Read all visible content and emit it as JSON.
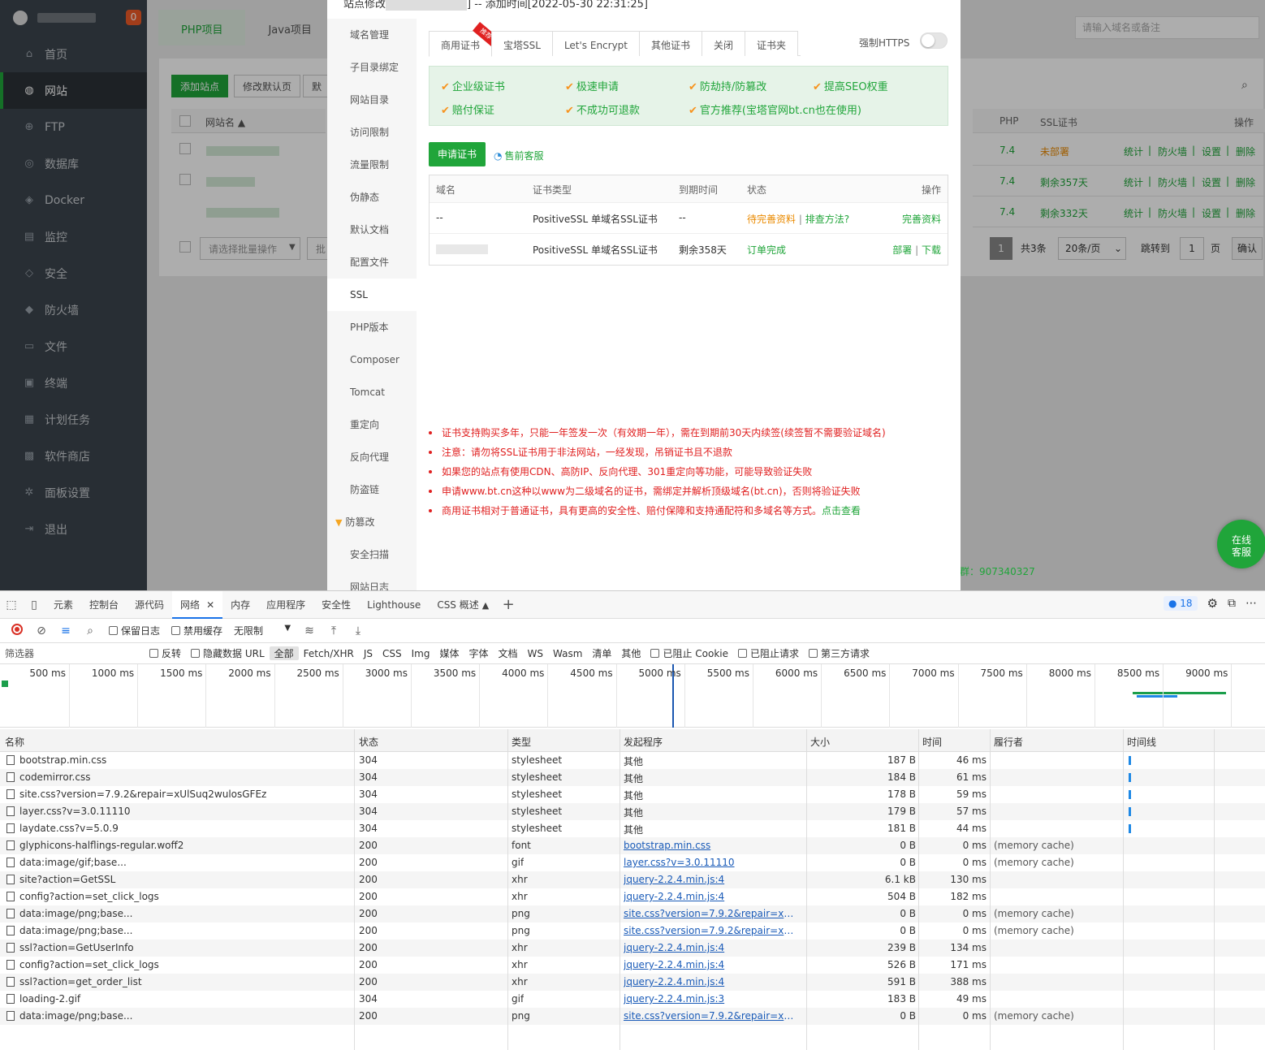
{
  "sidebar": {
    "badge": "0",
    "items": [
      {
        "label": "首页",
        "icon": "home-icon",
        "glyph": "⌂"
      },
      {
        "label": "网站",
        "icon": "globe-icon",
        "glyph": "◍"
      },
      {
        "label": "FTP",
        "icon": "ftp-icon",
        "glyph": "⊕"
      },
      {
        "label": "数据库",
        "icon": "database-icon",
        "glyph": "◎"
      },
      {
        "label": "Docker",
        "icon": "docker-icon",
        "glyph": "◈"
      },
      {
        "label": "监控",
        "icon": "monitor-icon",
        "glyph": "▤"
      },
      {
        "label": "安全",
        "icon": "shield-icon",
        "glyph": "◇"
      },
      {
        "label": "防火墙",
        "icon": "firewall-icon",
        "glyph": "◆"
      },
      {
        "label": "文件",
        "icon": "folder-icon",
        "glyph": "▭"
      },
      {
        "label": "终端",
        "icon": "terminal-icon",
        "glyph": "▣"
      },
      {
        "label": "计划任务",
        "icon": "calendar-icon",
        "glyph": "▦"
      },
      {
        "label": "软件商店",
        "icon": "apps-icon",
        "glyph": "▩"
      },
      {
        "label": "面板设置",
        "icon": "gear-icon",
        "glyph": "✲"
      },
      {
        "label": "退出",
        "icon": "logout-icon",
        "glyph": "⇥"
      }
    ]
  },
  "main": {
    "tabs": [
      "PHP项目",
      "Java项目"
    ],
    "buttons": {
      "add_site": "添加站点",
      "modify_default": "修改默认页",
      "default_partial": "默认"
    },
    "col_sitename": "网站名 ▲",
    "search_placeholder": "请输入域名或备注",
    "right_headers": {
      "php": "PHP",
      "ssl": "SSL证书",
      "ops": "操作"
    },
    "rows": [
      {
        "php": "7.4",
        "ssl": "未部署"
      },
      {
        "php": "7.4",
        "ssl": "剩余357天"
      },
      {
        "php": "7.4",
        "ssl": "剩余332天"
      }
    ],
    "row_ops": [
      "统计",
      "防火墙",
      "设置",
      "删除"
    ],
    "batch_placeholder": "请选择批量操作",
    "batch_btn_partial": "批量",
    "pager": {
      "page": "1",
      "total": "共3条",
      "per_page": "20条/页",
      "jump_label": "跳转到",
      "jump_value": "1",
      "page_unit": "页",
      "confirm": "确认"
    },
    "footer_partial": "群：907340327",
    "online_service": "在线客服"
  },
  "dialog": {
    "title_prefix": "站点修改",
    "title_suffix": "] -- 添加时间[2022-05-30 22:31:25]",
    "menu": [
      "域名管理",
      "子目录绑定",
      "网站目录",
      "访问限制",
      "流量限制",
      "伪静态",
      "默认文档",
      "配置文件",
      "SSL",
      "PHP版本",
      "Composer",
      "Tomcat",
      "重定向",
      "反向代理",
      "防盗链",
      "防篡改",
      "安全扫描",
      "网站日志"
    ],
    "tabs": [
      "商用证书",
      "宝塔SSL",
      "Let's Encrypt",
      "其他证书",
      "关闭",
      "证书夹"
    ],
    "recommend_ribbon": "推荐",
    "force_https": "强制HTTPS",
    "features": [
      "企业级证书",
      "极速申请",
      "防劫持/防篡改",
      "提高SEO权重",
      "赔付保证",
      "不成功可退款",
      "官方推荐(宝塔官网bt.cn也在使用)"
    ],
    "apply_btn": "申请证书",
    "presale": "售前客服",
    "table_headers": [
      "域名",
      "证书类型",
      "到期时间",
      "状态",
      "操作"
    ],
    "cert_rows": [
      {
        "domain": "--",
        "type": "PositiveSSL 单域名SSL证书",
        "expire": "--",
        "status": "待完善资料",
        "status_link": "排查方法?",
        "action1": "完善资料",
        "action2": ""
      },
      {
        "domain": "",
        "type": "PositiveSSL 单域名SSL证书",
        "expire": "剩余358天",
        "status": "订单完成",
        "status_link": "",
        "action1": "部署",
        "action2": "下载"
      }
    ],
    "notes": [
      "证书支持购买多年，只能一年签发一次（有效期一年），需在到期前30天内续签(续签暂不需要验证域名)",
      "注意：请勿将SSL证书用于非法网站，一经发现，吊销证书且不退款",
      "如果您的站点有使用CDN、高防IP、反向代理、301重定向等功能，可能导致验证失败",
      "申请www.bt.cn这种以www为二级域名的证书，需绑定并解析顶级域名(bt.cn)，否则将验证失败",
      "商用证书相对于普通证书，具有更高的安全性、赔付保障和支持通配符和多域名等方式。"
    ],
    "notes_link": "点击查看"
  },
  "devtools": {
    "tabs": [
      "元素",
      "控制台",
      "源代码",
      "网络",
      "内存",
      "应用程序",
      "安全性",
      "Lighthouse",
      "CSS 概述"
    ],
    "issues_count": "18",
    "toolbar": {
      "preserve_log": "保留日志",
      "disable_cache": "禁用缓存",
      "throttle": "无限制"
    },
    "filter": {
      "label": "筛选器",
      "invert": "反转",
      "hide_data_url": "隐藏数据 URL",
      "types": [
        "全部",
        "Fetch/XHR",
        "JS",
        "CSS",
        "Img",
        "媒体",
        "字体",
        "文档",
        "WS",
        "Wasm",
        "清单",
        "其他"
      ],
      "blocked_cookies": "已阻止 Cookie",
      "blocked_requests": "已阻止请求",
      "third_party": "第三方请求"
    },
    "timeline_ticks": [
      "500 ms",
      "1000 ms",
      "1500 ms",
      "2000 ms",
      "2500 ms",
      "3000 ms",
      "3500 ms",
      "4000 ms",
      "4500 ms",
      "5000 ms",
      "5500 ms",
      "6000 ms",
      "6500 ms",
      "7000 ms",
      "7500 ms",
      "8000 ms",
      "8500 ms",
      "9000 ms"
    ],
    "columns": [
      "名称",
      "状态",
      "类型",
      "发起程序",
      "大小",
      "时间",
      "履行者",
      "时间线"
    ],
    "requests": [
      {
        "name": "bootstrap.min.css",
        "status": "304",
        "type": "stylesheet",
        "initiator": "其他",
        "link": false,
        "size": "187 B",
        "time": "46 ms",
        "fulfilled": ""
      },
      {
        "name": "codemirror.css",
        "status": "304",
        "type": "stylesheet",
        "initiator": "其他",
        "link": false,
        "size": "184 B",
        "time": "61 ms",
        "fulfilled": ""
      },
      {
        "name": "site.css?version=7.9.2&repair=xUlSuq2wulosGFEz",
        "status": "304",
        "type": "stylesheet",
        "initiator": "其他",
        "link": false,
        "size": "178 B",
        "time": "59 ms",
        "fulfilled": ""
      },
      {
        "name": "layer.css?v=3.0.11110",
        "status": "304",
        "type": "stylesheet",
        "initiator": "其他",
        "link": false,
        "size": "179 B",
        "time": "57 ms",
        "fulfilled": ""
      },
      {
        "name": "laydate.css?v=5.0.9",
        "status": "304",
        "type": "stylesheet",
        "initiator": "其他",
        "link": false,
        "size": "181 B",
        "time": "44 ms",
        "fulfilled": ""
      },
      {
        "name": "glyphicons-halflings-regular.woff2",
        "status": "200",
        "type": "font",
        "initiator": "bootstrap.min.css",
        "link": true,
        "size": "0 B",
        "time": "0 ms",
        "fulfilled": "(memory cache)"
      },
      {
        "name": "data:image/gif;base...",
        "status": "200",
        "type": "gif",
        "initiator": "layer.css?v=3.0.11110",
        "link": true,
        "size": "0 B",
        "time": "0 ms",
        "fulfilled": "(memory cache)"
      },
      {
        "name": "site?action=GetSSL",
        "status": "200",
        "type": "xhr",
        "initiator": "jquery-2.2.4.min.js:4",
        "link": true,
        "size": "6.1 kB",
        "time": "130 ms",
        "fulfilled": ""
      },
      {
        "name": "config?action=set_click_logs",
        "status": "200",
        "type": "xhr",
        "initiator": "jquery-2.2.4.min.js:4",
        "link": true,
        "size": "504 B",
        "time": "182 ms",
        "fulfilled": ""
      },
      {
        "name": "data:image/png;base...",
        "status": "200",
        "type": "png",
        "initiator": "site.css?version=7.9.2&repair=xUlSuq2...",
        "link": true,
        "size": "0 B",
        "time": "0 ms",
        "fulfilled": "(memory cache)"
      },
      {
        "name": "data:image/png;base...",
        "status": "200",
        "type": "png",
        "initiator": "site.css?version=7.9.2&repair=xUlSuq2...",
        "link": true,
        "size": "0 B",
        "time": "0 ms",
        "fulfilled": "(memory cache)"
      },
      {
        "name": "ssl?action=GetUserInfo",
        "status": "200",
        "type": "xhr",
        "initiator": "jquery-2.2.4.min.js:4",
        "link": true,
        "size": "239 B",
        "time": "134 ms",
        "fulfilled": ""
      },
      {
        "name": "config?action=set_click_logs",
        "status": "200",
        "type": "xhr",
        "initiator": "jquery-2.2.4.min.js:4",
        "link": true,
        "size": "526 B",
        "time": "171 ms",
        "fulfilled": ""
      },
      {
        "name": "ssl?action=get_order_list",
        "status": "200",
        "type": "xhr",
        "initiator": "jquery-2.2.4.min.js:4",
        "link": true,
        "size": "591 B",
        "time": "388 ms",
        "fulfilled": ""
      },
      {
        "name": "loading-2.gif",
        "status": "304",
        "type": "gif",
        "initiator": "jquery-2.2.4.min.js:3",
        "link": true,
        "size": "183 B",
        "time": "49 ms",
        "fulfilled": ""
      },
      {
        "name": "data:image/png;base...",
        "status": "200",
        "type": "png",
        "initiator": "site.css?version=7.9.2&repair=xUlSuq2...",
        "link": true,
        "size": "0 B",
        "time": "0 ms",
        "fulfilled": "(memory cache)"
      }
    ]
  }
}
